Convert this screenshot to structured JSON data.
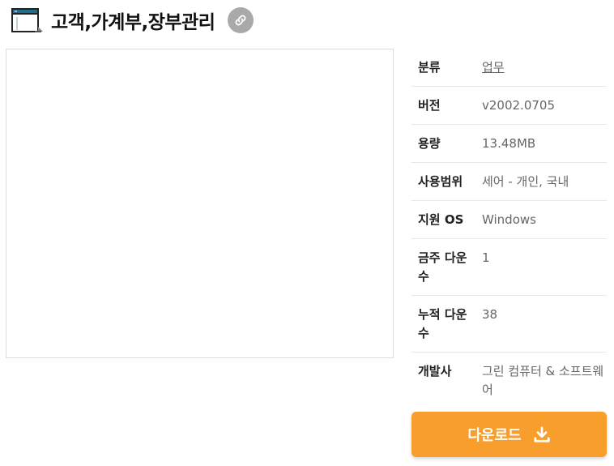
{
  "title": "고객,가계부,장부관리",
  "icons": {
    "app": "application-window-icon",
    "link": "link-icon",
    "download": "download-icon"
  },
  "colors": {
    "accent": "#f79e2d",
    "link_button_bg": "#a9a9a9"
  },
  "info": {
    "category": {
      "label": "분류",
      "value": "업무"
    },
    "version": {
      "label": "버전",
      "value": "v2002.0705"
    },
    "size": {
      "label": "용량",
      "value": "13.48MB"
    },
    "license": {
      "label": "사용범위",
      "value": "세어 - 개인, 국내"
    },
    "os": {
      "label": "지원 OS",
      "value": "Windows"
    },
    "weekly_downloads": {
      "label": "금주 다운수",
      "value": "1"
    },
    "total_downloads": {
      "label": "누적 다운수",
      "value": "38"
    },
    "developer": {
      "label": "개발사",
      "value": "그린 컴퓨터 & 소프트웨어"
    }
  },
  "download_button": {
    "label": "다운로드"
  }
}
